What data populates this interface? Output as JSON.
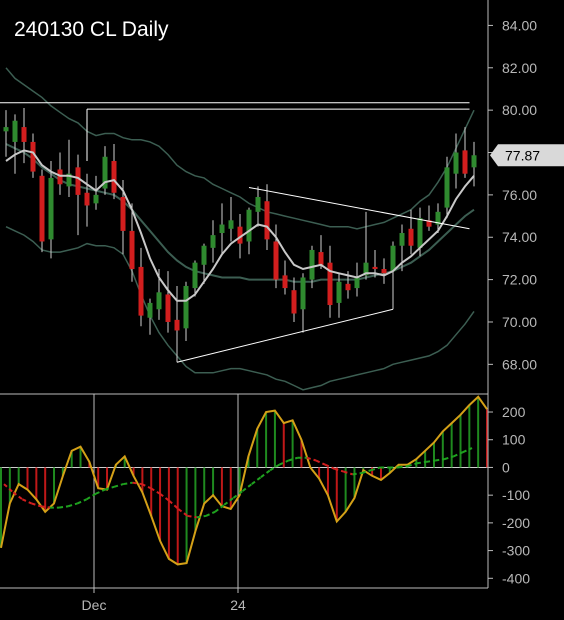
{
  "title": "240130 CL Daily",
  "last_price_label": "77.87",
  "colors": {
    "background": "#000000",
    "up_candle": "#2f8a2f",
    "down_candle": "#d21e1e",
    "wick": "#cfcfcf",
    "moving_average": "#c8c8c8",
    "bollinger_band": "#3c5e52",
    "trendline": "#ffffff",
    "histogram_up": "#1f8a1f",
    "histogram_down": "#c01818",
    "oscillator_line": "#d4a017",
    "signal_up": "#1fa31f",
    "signal_down": "#d21e1e",
    "price_tag": "#d9d9d9"
  },
  "chart_data": [
    {
      "type": "candlestick",
      "title": "240130 CL Daily",
      "x_tick_labels": [
        {
          "label": "Dec",
          "index": 9
        },
        {
          "label": "24",
          "index": 25
        }
      ],
      "y_ticks": [
        "68.00",
        "70.00",
        "72.00",
        "74.00",
        "76.00",
        "78.00",
        "80.00",
        "82.00",
        "84.00"
      ],
      "ylim": [
        66.6,
        85.2
      ],
      "last_price": 77.87,
      "ohlc": [
        [
          79.0,
          80.0,
          77.8,
          79.2
        ],
        [
          78.5,
          79.8,
          77.0,
          79.5
        ],
        [
          79.2,
          80.1,
          77.5,
          78.5
        ],
        [
          78.5,
          78.9,
          76.8,
          77.1
        ],
        [
          76.9,
          77.2,
          73.3,
          73.8
        ],
        [
          73.9,
          77.6,
          73.0,
          76.8
        ],
        [
          77.2,
          78.0,
          76.0,
          76.5
        ],
        [
          76.4,
          78.6,
          75.9,
          77.0
        ],
        [
          77.3,
          77.9,
          74.1,
          76.0
        ],
        [
          76.1,
          77.0,
          74.5,
          75.5
        ],
        [
          75.6,
          76.9,
          75.3,
          76.0
        ],
        [
          76.3,
          78.3,
          76.0,
          77.8
        ],
        [
          77.6,
          78.4,
          75.8,
          76.1
        ],
        [
          75.9,
          76.7,
          73.2,
          74.3
        ],
        [
          74.3,
          75.6,
          71.9,
          72.5
        ],
        [
          72.6,
          73.5,
          69.8,
          70.3
        ],
        [
          70.2,
          71.1,
          69.4,
          70.9
        ],
        [
          70.6,
          72.5,
          70.1,
          71.4
        ],
        [
          71.3,
          72.4,
          69.5,
          70.0
        ],
        [
          70.1,
          71.7,
          68.1,
          69.6
        ],
        [
          69.7,
          71.9,
          69.1,
          71.7
        ],
        [
          71.6,
          72.9,
          71.2,
          72.8
        ],
        [
          72.7,
          73.7,
          71.8,
          73.6
        ],
        [
          73.5,
          74.8,
          72.8,
          74.1
        ],
        [
          74.2,
          75.6,
          73.2,
          74.6
        ],
        [
          74.4,
          75.9,
          73.8,
          74.8
        ],
        [
          74.5,
          75.1,
          73.0,
          73.7
        ],
        [
          73.8,
          75.4,
          73.2,
          75.3
        ],
        [
          75.2,
          76.4,
          74.5,
          75.9
        ],
        [
          75.7,
          76.5,
          73.4,
          73.9
        ],
        [
          73.8,
          74.6,
          71.6,
          72.0
        ],
        [
          72.2,
          72.9,
          71.3,
          71.6
        ],
        [
          71.5,
          72.1,
          70.0,
          70.4
        ],
        [
          70.6,
          72.3,
          69.5,
          72.1
        ],
        [
          72.0,
          73.6,
          71.6,
          73.4
        ],
        [
          73.3,
          74.1,
          72.5,
          72.7
        ],
        [
          72.8,
          73.6,
          70.2,
          70.8
        ],
        [
          70.9,
          72.3,
          70.2,
          71.9
        ],
        [
          71.8,
          72.4,
          71.1,
          71.5
        ],
        [
          71.6,
          72.8,
          71.2,
          72.1
        ],
        [
          72.2,
          75.2,
          72.0,
          72.8
        ],
        [
          72.6,
          73.4,
          72.1,
          72.5
        ],
        [
          72.5,
          73.0,
          71.8,
          72.3
        ],
        [
          72.4,
          73.8,
          70.6,
          73.6
        ],
        [
          73.6,
          74.6,
          72.4,
          74.2
        ],
        [
          74.4,
          75.3,
          73.2,
          73.6
        ],
        [
          73.5,
          75.4,
          73.1,
          74.9
        ],
        [
          74.8,
          75.5,
          74.3,
          74.5
        ],
        [
          74.6,
          75.6,
          74.2,
          75.2
        ],
        [
          75.4,
          77.8,
          74.9,
          77.3
        ],
        [
          77.0,
          78.9,
          76.3,
          78.0
        ],
        [
          78.1,
          79.2,
          76.8,
          77.0
        ],
        [
          77.3,
          78.5,
          76.4,
          77.87
        ]
      ],
      "moving_average": [
        77.6,
        77.9,
        78.1,
        78.0,
        77.4,
        77.1,
        76.9,
        76.9,
        76.8,
        76.5,
        76.2,
        76.6,
        76.7,
        76.2,
        75.3,
        74.2,
        73.0,
        72.1,
        71.5,
        71.0,
        71.0,
        71.3,
        71.9,
        72.5,
        73.2,
        73.7,
        74.0,
        74.3,
        74.6,
        74.5,
        74.0,
        73.3,
        72.7,
        72.5,
        72.6,
        72.7,
        72.4,
        72.3,
        72.2,
        72.1,
        72.3,
        72.3,
        72.2,
        72.4,
        72.8,
        73.1,
        73.5,
        73.9,
        74.3,
        75.0,
        75.8,
        76.4,
        76.9
      ],
      "bollinger_upper": [
        82.0,
        81.5,
        81.2,
        80.9,
        80.6,
        80.2,
        79.9,
        79.6,
        79.4,
        79.0,
        78.8,
        78.9,
        78.9,
        78.7,
        78.6,
        78.6,
        78.5,
        78.3,
        77.9,
        77.4,
        77.1,
        76.9,
        76.8,
        76.5,
        76.3,
        76.1,
        75.9,
        75.6,
        75.4,
        75.2,
        75.1,
        75.0,
        74.9,
        74.8,
        74.7,
        74.6,
        74.5,
        74.5,
        74.5,
        74.4,
        74.5,
        74.6,
        74.7,
        74.9,
        75.1,
        75.3,
        75.7,
        76.0,
        76.6,
        77.3,
        78.2,
        79.1,
        80.0
      ],
      "bollinger_lower": [
        74.5,
        74.3,
        74.1,
        73.8,
        73.4,
        73.3,
        73.3,
        73.4,
        73.5,
        73.7,
        73.6,
        73.6,
        73.5,
        73.2,
        72.4,
        71.3,
        70.3,
        69.5,
        68.9,
        68.4,
        67.9,
        67.6,
        67.6,
        67.6,
        67.7,
        67.8,
        67.8,
        67.7,
        67.6,
        67.5,
        67.3,
        67.2,
        67.0,
        66.8,
        66.9,
        67.0,
        67.2,
        67.3,
        67.4,
        67.5,
        67.6,
        67.7,
        67.8,
        68.0,
        68.1,
        68.2,
        68.3,
        68.4,
        68.6,
        68.9,
        69.4,
        69.9,
        70.5
      ],
      "bollinger_middle": [
        78.4,
        78.2,
        78.0,
        77.7,
        77.3,
        77.0,
        76.7,
        76.5,
        76.4,
        76.3,
        76.2,
        76.1,
        76.0,
        75.7,
        75.3,
        74.8,
        74.3,
        73.8,
        73.3,
        72.9,
        72.6,
        72.4,
        72.3,
        72.2,
        72.1,
        72.1,
        72.1,
        72.0,
        72.0,
        72.0,
        72.0,
        72.0,
        71.9,
        71.9,
        71.9,
        72.0,
        72.0,
        72.0,
        72.0,
        72.0,
        72.1,
        72.2,
        72.3,
        72.4,
        72.6,
        72.8,
        73.1,
        73.4,
        73.8,
        74.2,
        74.6,
        75.0,
        75.3
      ],
      "trendlines": [
        {
          "points": [
            [
              -1,
              80.35
            ],
            [
              51.5,
              80.35
            ]
          ]
        },
        {
          "points": [
            [
              9,
              80.05
            ],
            [
              51.5,
              80.05
            ]
          ]
        },
        {
          "points": [
            [
              9,
              80.05
            ],
            [
              9,
              77.6
            ]
          ]
        },
        {
          "points": [
            [
              27,
              76.35
            ],
            [
              51.5,
              74.4
            ]
          ]
        },
        {
          "points": [
            [
              19,
              68.1
            ],
            [
              43,
              70.6
            ]
          ]
        }
      ]
    },
    {
      "type": "histogram_oscillator",
      "y_ticks": [
        "200",
        "100",
        "0",
        "-100",
        "-200",
        "-300",
        "-400"
      ],
      "ylim": [
        -435,
        265
      ],
      "histogram": [
        -290,
        -130,
        -60,
        -80,
        -115,
        -160,
        -130,
        -30,
        60,
        75,
        20,
        -75,
        -80,
        10,
        40,
        -30,
        -90,
        -175,
        -265,
        -330,
        -350,
        -345,
        -230,
        -130,
        -100,
        -140,
        -150,
        -100,
        40,
        140,
        200,
        205,
        160,
        170,
        100,
        0,
        -40,
        -100,
        -195,
        -160,
        -110,
        -10,
        -30,
        -45,
        -20,
        10,
        10,
        30,
        60,
        90,
        130,
        160,
        190,
        225,
        255,
        210
      ],
      "signal": [
        -60,
        -90,
        -115,
        -130,
        -140,
        -145,
        -145,
        -140,
        -130,
        -115,
        -95,
        -80,
        -70,
        -60,
        -55,
        -60,
        -75,
        -95,
        -120,
        -150,
        -175,
        -180,
        -175,
        -160,
        -135,
        -110,
        -85,
        -60,
        -35,
        -10,
        10,
        25,
        35,
        35,
        25,
        10,
        -5,
        -15,
        -25,
        -20,
        -10,
        0,
        0,
        0,
        5,
        15,
        20,
        25,
        30,
        40,
        55,
        70
      ],
      "signal_crossover_index": 14
    }
  ]
}
